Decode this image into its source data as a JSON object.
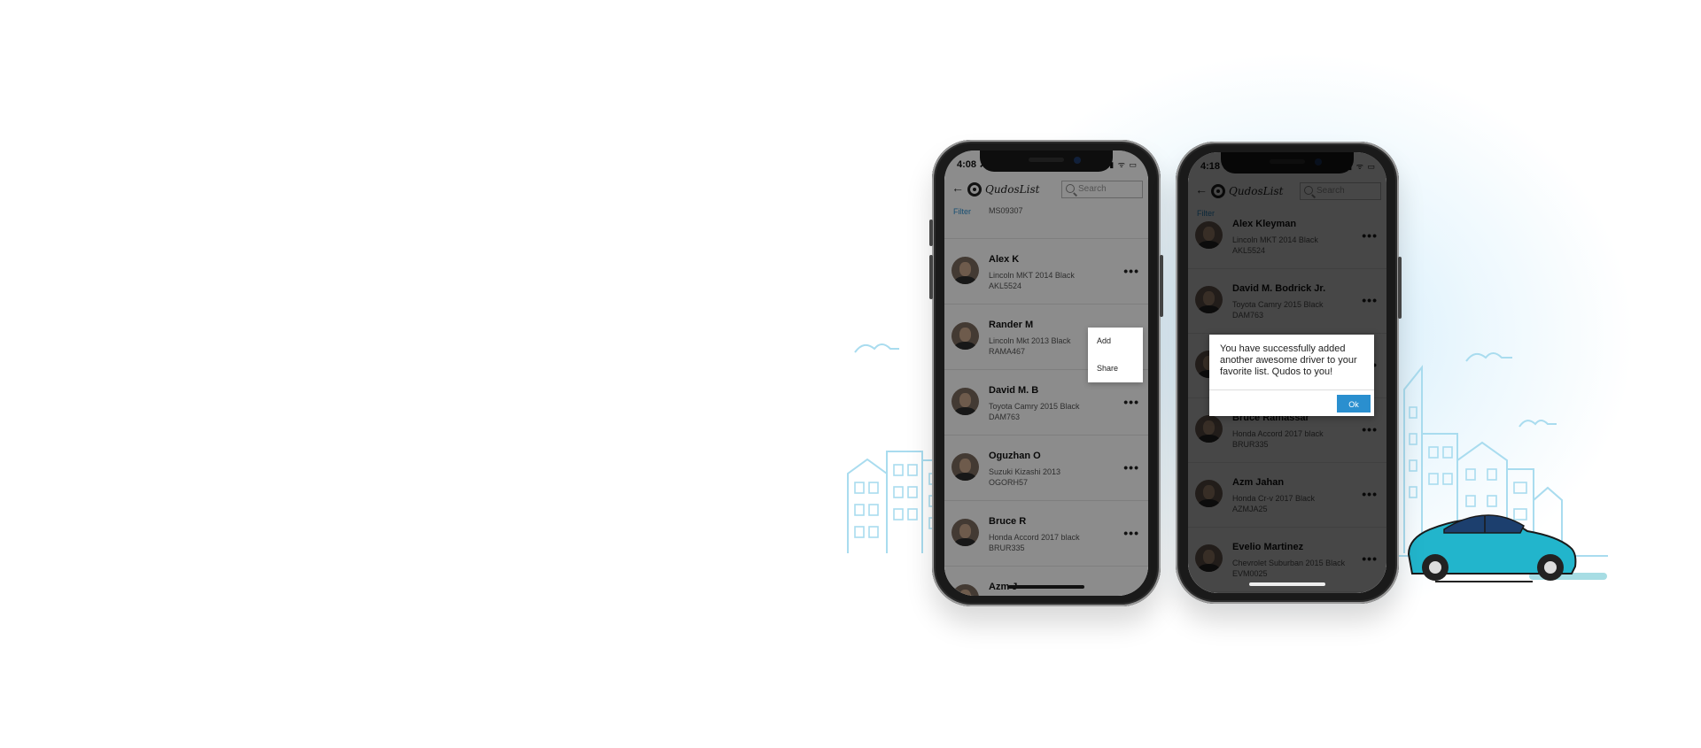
{
  "colors": {
    "accent": "#2a8fcf",
    "city_outline": "#a9dcef",
    "car_body": "#22b5cc",
    "overlay": "rgba(0,0,0,0.45)",
    "overlay_dark": "rgba(0,0,0,0.72)"
  },
  "icons": {
    "back": "←",
    "more": "•••",
    "status": "▮▮ ᯤ ▭"
  },
  "phone_left": {
    "status_time": "4:08 ➚",
    "logo_text": "QudosList",
    "search_placeholder": "Search",
    "filter_label": "Filter",
    "partial_top_plate": "MS09307",
    "drivers": [
      {
        "name": "Alex K",
        "car": "Lincoln MKT 2014 Black",
        "plate": "AKL5524"
      },
      {
        "name": "Rander M",
        "car": "Lincoln Mkt 2013 Black",
        "plate": "RAMA467"
      },
      {
        "name": "David M. B",
        "car": "Toyota Camry 2015 Black",
        "plate": "DAM763"
      },
      {
        "name": "Oguzhan O",
        "car": "Suzuki Kizashi 2013",
        "plate": "OGORH57"
      },
      {
        "name": "Bruce R",
        "car": "Honda Accord 2017 black",
        "plate": "BRUR335"
      },
      {
        "name": "Azm J",
        "car": "",
        "plate": ""
      }
    ],
    "context_menu": {
      "add": "Add",
      "share": "Share"
    }
  },
  "phone_right": {
    "status_time": "4:18 ➚",
    "logo_text": "QudosList",
    "search_placeholder": "Search",
    "filter_label": "Filter",
    "drivers": [
      {
        "name": "Alex Kleyman",
        "car": "Lincoln MKT 2014 Black",
        "plate": "AKL5524"
      },
      {
        "name": "David M. Bodrick Jr.",
        "car": "Toyota Camry 2015 Black",
        "plate": "DAM763"
      },
      {
        "name": "",
        "car": "",
        "plate": ""
      },
      {
        "name": "Bruce Ramassar",
        "car": "Honda Accord 2017 black",
        "plate": "BRUR335"
      },
      {
        "name": "Azm Jahan",
        "car": "Honda Cr-v 2017 Black",
        "plate": "AZMJA25"
      },
      {
        "name": "Evelio Martinez",
        "car": "Chevrolet Suburban 2015 Black",
        "plate": "EVM0025"
      }
    ],
    "dialog": {
      "message": "You have successfully added another awesome driver to your favorite list. Qudos to you!",
      "ok_label": "Ok"
    }
  }
}
